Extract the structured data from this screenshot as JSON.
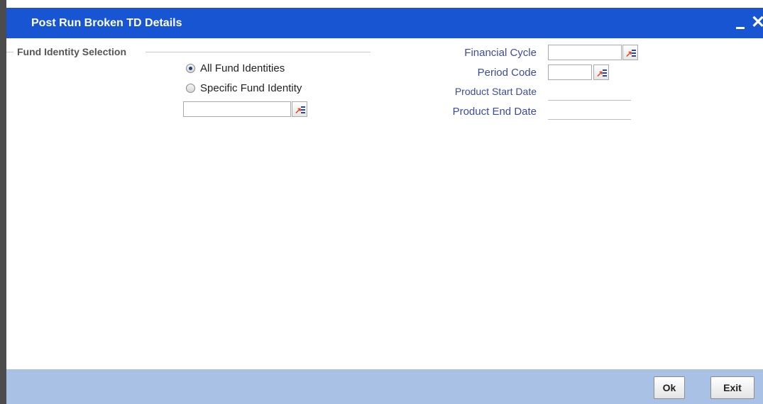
{
  "window": {
    "title": "Post Run Broken TD Details"
  },
  "fund_identity_selection": {
    "legend": "Fund Identity Selection",
    "options": [
      {
        "label": "All Fund Identities",
        "selected": true
      },
      {
        "label": "Specific Fund Identity",
        "selected": false
      }
    ],
    "fund_identity_value": ""
  },
  "fields": {
    "financial_cycle": {
      "label": "Financial Cycle",
      "value": ""
    },
    "period_code": {
      "label": "Period Code",
      "value": ""
    },
    "product_start_date": {
      "label": "Product Start Date",
      "value": ""
    },
    "product_end_date": {
      "label": "Product End Date",
      "value": ""
    }
  },
  "footer": {
    "ok_label": "Ok",
    "exit_label": "Exit"
  },
  "colors": {
    "titlebar": "#1855d3",
    "footer": "#a9c1e4",
    "label": "#3c4b9e"
  },
  "icons": [
    "lov-icon",
    "minimize-icon",
    "close-icon",
    "radio-icon"
  ]
}
